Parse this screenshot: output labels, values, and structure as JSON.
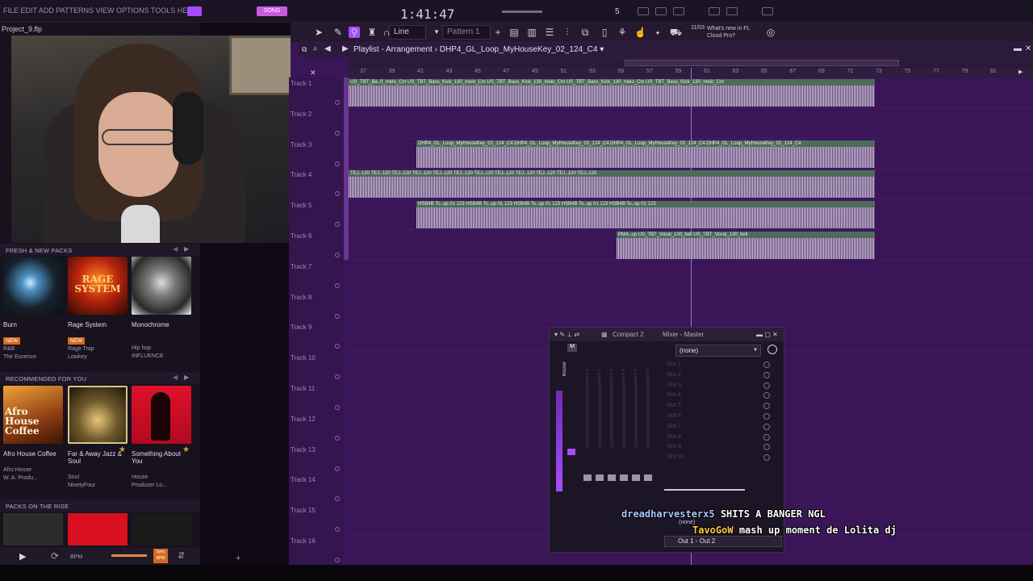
{
  "topbar": {
    "menu": "FILE EDIT ADD PATTERNS VIEW OPTIONS TOOLS HELP",
    "time": "1:41:47",
    "mode_badge": "SONG",
    "pattern_num": "5"
  },
  "toolbar2": {
    "snap_value": "Line",
    "pattern_name": "Pattern 1",
    "news_date": "11/03",
    "news_text": "What's new in FL Cloud Pro?"
  },
  "project": {
    "filename": "Project_9.flp"
  },
  "browser": {
    "fresh_header": "FRESH & NEW PACKS",
    "fresh_packs": [
      {
        "name": "Burn",
        "badge": "NEW",
        "genre": "R&B",
        "artist": "The Essence"
      },
      {
        "name": "Rage System",
        "badge": "NEW",
        "genre": "Rage Trap",
        "artist": "Lowkey"
      },
      {
        "name": "Monochrome",
        "badge": "",
        "genre": "Hip hop",
        "artist": "INFLUENCE"
      }
    ],
    "recommended_header": "RECOMMENDED FOR YOU",
    "recommended_packs": [
      {
        "name": "Afro House Coffee",
        "genre": "Afro House",
        "artist": "W. A. Produ..."
      },
      {
        "name": "Far & Away Jazz & Soul",
        "genre": "Soul",
        "artist": "NinetyFour"
      },
      {
        "name": "Something About You",
        "genre": "House",
        "artist": "Producer Lo..."
      }
    ],
    "rise_header": "PACKS ON THE RISE",
    "art_text": {
      "rage": "RAGE SYSTEM",
      "afro": "Afro House Coffee"
    }
  },
  "bottom": {
    "bpm_label": "BPM",
    "sync_label": "Sync BPM"
  },
  "playlist": {
    "title": "Playlist - Arrangement",
    "pattern": "DHP4_GL_Loop_MyHouseKey_02_124_C4",
    "ruler": [
      "37",
      "39",
      "41",
      "43",
      "45",
      "47",
      "49",
      "51",
      "53",
      "55",
      "57",
      "59",
      "61",
      "63",
      "65",
      "67",
      "69",
      "71",
      "73",
      "75",
      "77",
      "79",
      "81"
    ],
    "tracks": [
      "Track 1",
      "Track 2",
      "Track 3",
      "Track 4",
      "Track 5",
      "Track 6",
      "Track 7",
      "Track 8",
      "Track 9",
      "Track 10",
      "Track 11",
      "Track 12",
      "Track 13",
      "Track 14",
      "Track 15",
      "Track 16"
    ],
    "clips": {
      "t1": "US_TBT_Ba..0_melo_Cm   US_TBT_Bass_Kick_130_melo_Cm   US_TBT_Bass_Kick_130_melo_Cm   US_TBT_Bass_Kick_130_melo_Cm   US_TBT_Bass_Kick_130_melo_Cm",
      "t3": "DHP4_GL_Loop_MyHouseKey_02_124_C4   DHP4_GL_Loop_MyHouseKey_02_124_C4   DHP4_GL_Loop_MyHouseKey_02_124_C4   DHP4_GL_Loop_MyHouseKey_02_124_C4",
      "t4": "TEJ..120  TEJ..120  TEJ..120  TEJ..120  TEJ..120  TEJ..120  TEJ..120  TEJ..120  TEJ..120  TEJ..120  TEJ..120  TEJ..120",
      "t5": "HSB4B To..op 01 123  HSB4B To..op 01 123  HSB4B To..op 01 123  HSB4B To..op 01 123  HSB4B To..op 01 123",
      "t6": "PMA..up   US_TBT_Vocal_130_bell   US_TBT_Vocal_130_bell"
    }
  },
  "mixer": {
    "title": "Compact 2",
    "title2": "Mixer - Master",
    "master_label": "Master",
    "preset": "(none)",
    "slots": [
      "Slot 1",
      "Slot 2",
      "Slot 3",
      "Slot 4",
      "Slot 5",
      "Slot 6",
      "Slot 7",
      "Slot 8",
      "Slot 9",
      "Slot 10"
    ],
    "insert_labels": [
      "Insert 1",
      "Insert 2",
      "Insert 3",
      "Insert 4",
      "Insert 5",
      "Insert 6"
    ],
    "output_none": "(none)",
    "output": "Out 1 - Out 2"
  },
  "chat": [
    {
      "user": "dreadharvesterx5",
      "message": "SHITS A BANGER NGL"
    },
    {
      "user": "TavoGoW",
      "message": "mash up moment de Lolita dj"
    }
  ],
  "colors": {
    "accent": "#a64dff",
    "clip_label": "#4f6b5a",
    "playlist_bg": "#3a1659",
    "badge": "#d66a1f"
  }
}
